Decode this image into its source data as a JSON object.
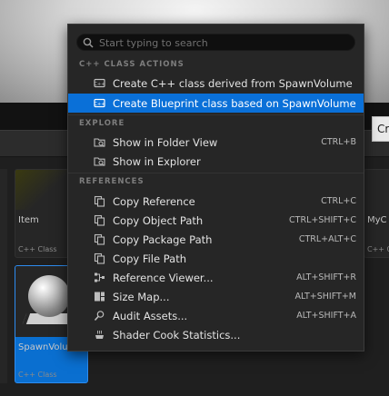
{
  "background": {
    "tooltip_text": "Cr",
    "tiles": [
      {
        "name": "Item",
        "type": "C++ Class"
      },
      {
        "name": "SpawnVolu",
        "type": "C++ Class"
      },
      {
        "name": "MyC",
        "type": "C++ C"
      }
    ]
  },
  "search": {
    "placeholder": "Start typing to search"
  },
  "sections": {
    "cpp": "C++ CLASS ACTIONS",
    "explore": "EXPLORE",
    "references": "REFERENCES"
  },
  "cpp_items": [
    {
      "label": "Create C++ class derived from SpawnVolume",
      "icon": "cpp-class-icon"
    },
    {
      "label": "Create Blueprint class based on SpawnVolume",
      "icon": "blueprint-class-icon",
      "selected": true
    }
  ],
  "explore_items": [
    {
      "label": "Show in Folder View",
      "shortcut": "CTRL+B",
      "icon": "folder-search-icon"
    },
    {
      "label": "Show in Explorer",
      "shortcut": "",
      "icon": "folder-search-icon"
    }
  ],
  "reference_items": [
    {
      "label": "Copy Reference",
      "shortcut": "CTRL+C",
      "icon": "copy-icon"
    },
    {
      "label": "Copy Object Path",
      "shortcut": "CTRL+SHIFT+C",
      "icon": "copy-icon"
    },
    {
      "label": "Copy Package Path",
      "shortcut": "CTRL+ALT+C",
      "icon": "copy-icon"
    },
    {
      "label": "Copy File Path",
      "shortcut": "",
      "icon": "copy-icon"
    },
    {
      "label": "Reference Viewer...",
      "shortcut": "ALT+SHIFT+R",
      "icon": "reference-viewer-icon"
    },
    {
      "label": "Size Map...",
      "shortcut": "ALT+SHIFT+M",
      "icon": "size-map-icon"
    },
    {
      "label": "Audit Assets...",
      "shortcut": "ALT+SHIFT+A",
      "icon": "audit-icon"
    },
    {
      "label": "Shader Cook Statistics...",
      "shortcut": "",
      "icon": "shader-icon"
    }
  ],
  "colors": {
    "selection": "#0a70d8",
    "menu_background": "#262626",
    "tile_selected": "#0a6fd0"
  }
}
